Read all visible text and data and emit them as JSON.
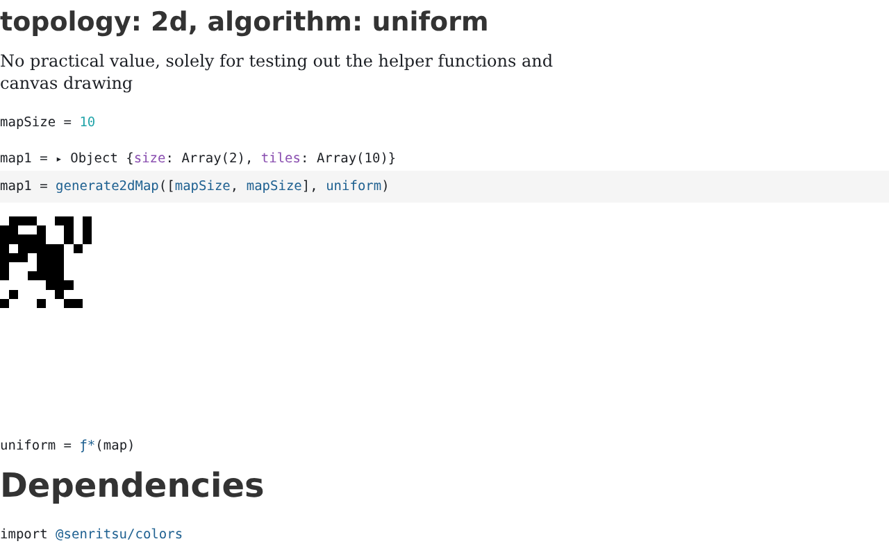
{
  "title": "topology: 2d, algorithm: uniform",
  "description": "No practical value, solely for testing out the helper functions and canvas drawing",
  "cells": [
    {
      "kind": "code",
      "highlighted": false,
      "tokens": [
        {
          "text": "mapSize = ",
          "kind": "plain"
        },
        {
          "text": "10",
          "kind": "number"
        }
      ]
    },
    {
      "kind": "code",
      "highlighted": false,
      "tokens": [
        {
          "text": "map1 = ",
          "kind": "plain"
        },
        {
          "text": "▸",
          "kind": "caret"
        },
        {
          "text": " Object {",
          "kind": "plain"
        },
        {
          "text": "size",
          "kind": "key"
        },
        {
          "text": ": Array(2), ",
          "kind": "plain"
        },
        {
          "text": "tiles",
          "kind": "key"
        },
        {
          "text": ": Array(10)}",
          "kind": "plain"
        }
      ]
    },
    {
      "kind": "code",
      "highlighted": true,
      "tokens": [
        {
          "text": "map1 = ",
          "kind": "plain"
        },
        {
          "text": "generate2dMap",
          "kind": "name"
        },
        {
          "text": "([",
          "kind": "plain"
        },
        {
          "text": "mapSize",
          "kind": "name"
        },
        {
          "text": ", ",
          "kind": "plain"
        },
        {
          "text": "mapSize",
          "kind": "name"
        },
        {
          "text": "], ",
          "kind": "plain"
        },
        {
          "text": "uniform",
          "kind": "name"
        },
        {
          "text": ")",
          "kind": "plain"
        }
      ]
    },
    {
      "kind": "map"
    },
    {
      "kind": "code",
      "highlighted": false,
      "tokens": [
        {
          "text": "uniform = ",
          "kind": "plain"
        },
        {
          "text": "ƒ*",
          "kind": "name"
        },
        {
          "text": "(map)",
          "kind": "plain"
        }
      ]
    },
    {
      "kind": "heading",
      "text": "Dependencies"
    },
    {
      "kind": "code",
      "highlighted": false,
      "tokens": [
        {
          "text": "import ",
          "kind": "plain"
        },
        {
          "text": "@senritsu/colors",
          "kind": "name"
        }
      ]
    }
  ]
}
